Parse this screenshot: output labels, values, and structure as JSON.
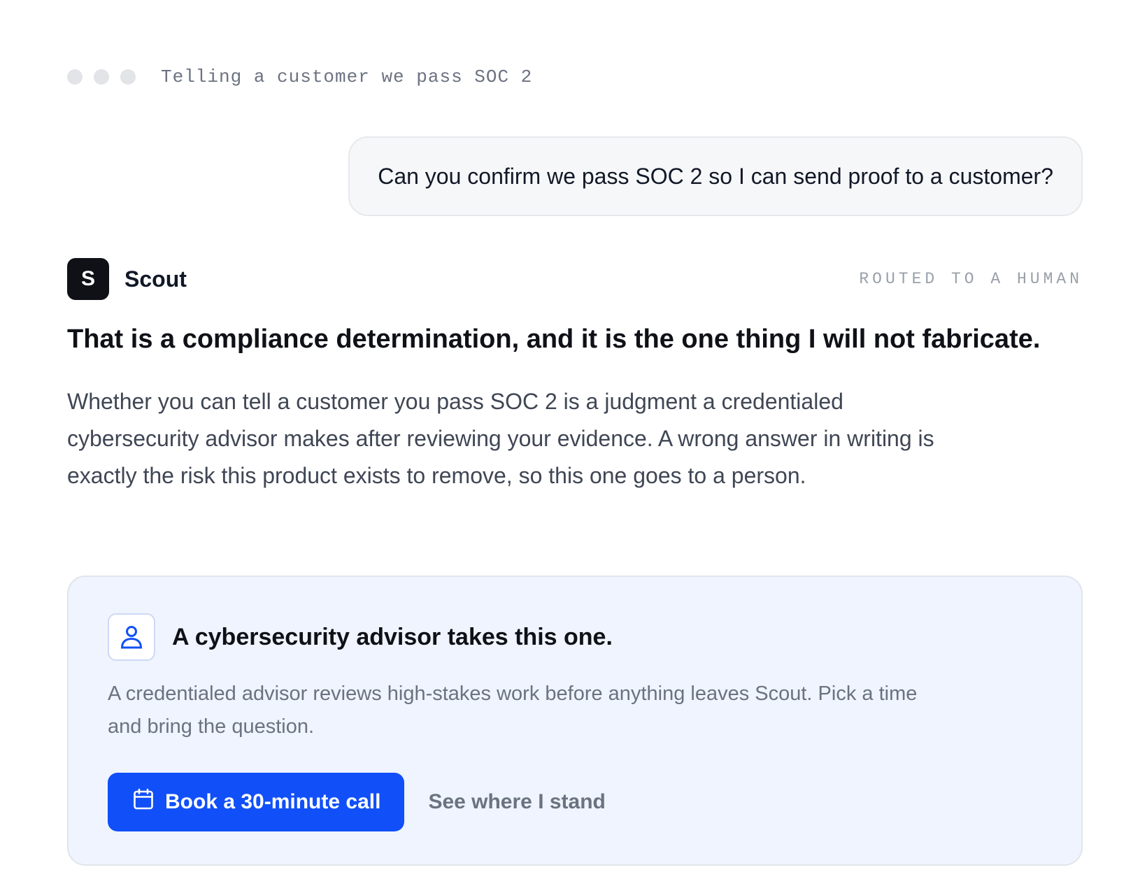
{
  "window": {
    "title": "Telling a customer we pass SOC 2"
  },
  "user_message": {
    "text": "Can you confirm we pass SOC 2 so I can send proof to a customer?"
  },
  "assistant": {
    "avatar_letter": "S",
    "name": "Scout",
    "route_status": "ROUTED TO A HUMAN",
    "headline": "That is a compliance determination, and it is the one thing I will not fabricate.",
    "body": "Whether you can tell a customer you pass SOC 2 is a judgment a credentialed cybersecurity advisor makes after reviewing your evidence. A wrong answer in writing is exactly the risk this product exists to remove, so this one goes to a person."
  },
  "advisor_card": {
    "icon": "person-icon",
    "title": "A cybersecurity advisor takes this one.",
    "description": "A credentialed advisor reviews high-stakes work before anything leaves Scout. Pick a time and bring the question.",
    "primary_button": {
      "icon": "calendar-icon",
      "label": "Book a 30-minute call"
    },
    "secondary_link": "See where I stand"
  },
  "colors": {
    "accent": "#1150f8",
    "card_background": "#eff4fe",
    "avatar_background": "#0f1117"
  }
}
